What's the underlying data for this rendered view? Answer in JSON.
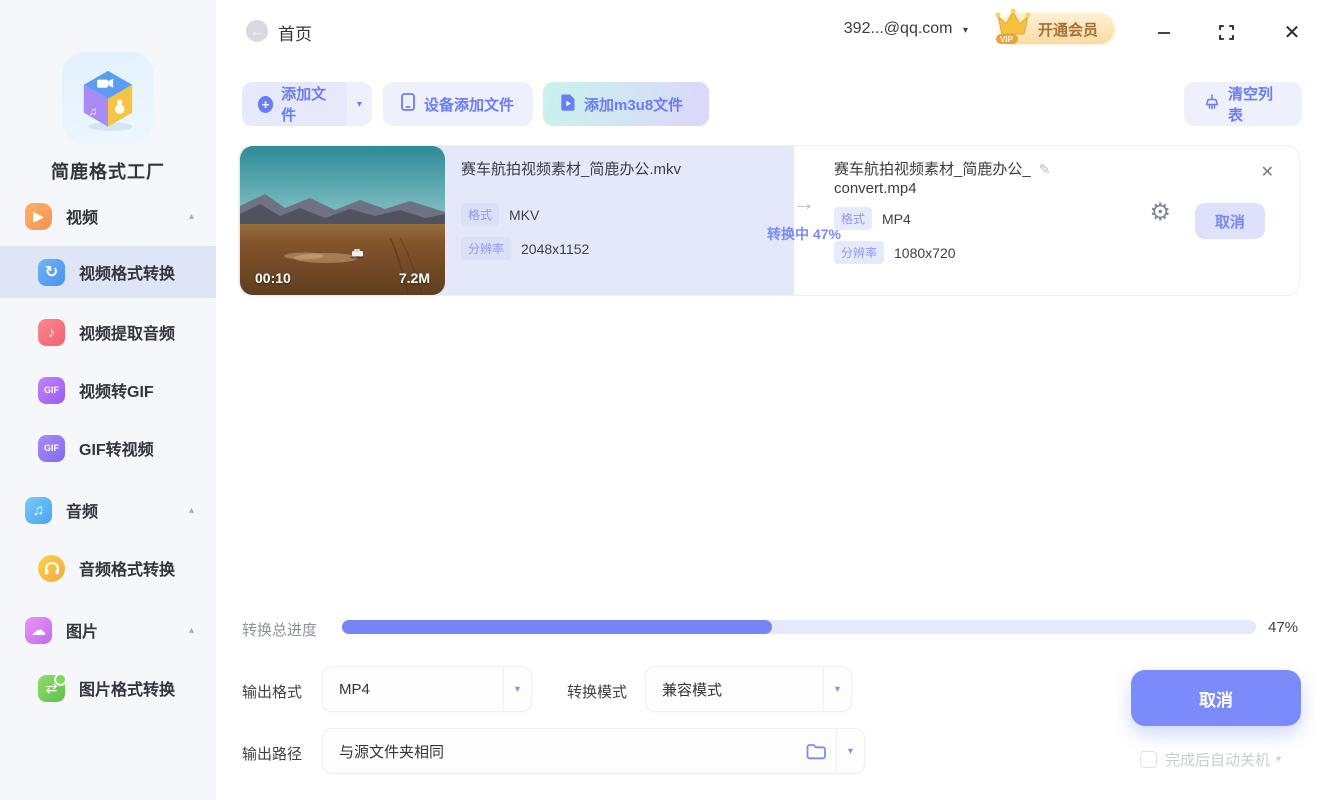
{
  "colors": {
    "accent": "#6e80f6",
    "accent_light": "#e6e9fb",
    "sidebar_active_bg": "#e0e4f7",
    "card_source_bg": "#e4e8fa",
    "progress_fill": "#7585f7",
    "status_text": "#7b8af8",
    "vip_text": "#a96f33"
  },
  "sidebar": {
    "app_name": "简鹿格式工厂",
    "items": [
      {
        "label": "视频",
        "icon": "video-icon",
        "group": true
      },
      {
        "label": "视频格式转换",
        "icon": "video-convert-icon",
        "active": true
      },
      {
        "label": "视频提取音频",
        "icon": "music-note-icon"
      },
      {
        "label": "视频转GIF",
        "icon": "gif-icon"
      },
      {
        "label": "GIF转视频",
        "icon": "gif-icon"
      },
      {
        "label": "音频",
        "icon": "audio-icon",
        "group": true
      },
      {
        "label": "音频格式转换",
        "icon": "headphone-icon"
      },
      {
        "label": "图片",
        "icon": "image-icon",
        "group": true
      },
      {
        "label": "图片格式转换",
        "icon": "image-convert-icon"
      }
    ]
  },
  "titlebar": {
    "back_label": "首页",
    "account": "392...@qq.com",
    "vip_badge": "VIP",
    "vip_label": "开通会员"
  },
  "toolbar": {
    "add_file": "添加文件",
    "add_from_device": "设备添加文件",
    "add_m3u8": "添加m3u8文件",
    "clear_list": "清空列表"
  },
  "task": {
    "duration": "00:10",
    "filesize": "7.2M",
    "source": {
      "filename": "赛车航拍视频素材_简鹿办公.mkv",
      "format_label": "格式",
      "format": "MKV",
      "resolution_label": "分辨率",
      "resolution": "2048x1152"
    },
    "status_text": "转换中 47%",
    "output": {
      "filename_line1": "赛车航拍视频素材_简鹿办公_",
      "filename_line2": "convert.mp4",
      "format_label": "格式",
      "format": "MP4",
      "resolution_label": "分辨率",
      "resolution": "1080x720"
    },
    "cancel_label": "取消"
  },
  "footer": {
    "progress_label": "转换总进度",
    "progress_percent": 47,
    "progress_text": "47%",
    "output_format_label": "输出格式",
    "output_format_value": "MP4",
    "convert_mode_label": "转换模式",
    "convert_mode_value": "兼容模式",
    "output_path_label": "输出路径",
    "output_path_value": "与源文件夹相同",
    "cancel_label": "取消",
    "shutdown_label": "完成后自动关机"
  }
}
